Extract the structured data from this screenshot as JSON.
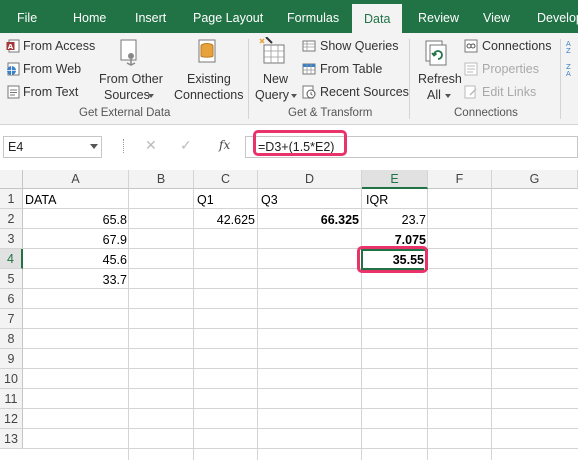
{
  "tabs": [
    {
      "label": "File"
    },
    {
      "label": "Home"
    },
    {
      "label": "Insert"
    },
    {
      "label": "Page Layout"
    },
    {
      "label": "Formulas"
    },
    {
      "label": "Data"
    },
    {
      "label": "Review"
    },
    {
      "label": "View"
    },
    {
      "label": "Develop"
    }
  ],
  "ribbon": {
    "get_external_data": {
      "label": "Get External Data",
      "from_access": "From Access",
      "from_web": "From Web",
      "from_text": "From Text",
      "from_other_sources_1": "From Other",
      "from_other_sources_2": "Sources",
      "existing_connections_1": "Existing",
      "existing_connections_2": "Connections"
    },
    "get_transform": {
      "label": "Get & Transform",
      "new_query_1": "New",
      "new_query_2": "Query",
      "show_queries": "Show Queries",
      "from_table": "From Table",
      "recent_sources": "Recent Sources"
    },
    "connections": {
      "label": "Connections",
      "refresh_all_1": "Refresh",
      "refresh_all_2": "All",
      "connections": "Connections",
      "properties": "Properties",
      "edit_links": "Edit Links"
    }
  },
  "formula_bar": {
    "name_box": "E4",
    "fx": "fx",
    "formula": "=D3+(1.5*E2)"
  },
  "columns": [
    "A",
    "B",
    "C",
    "D",
    "E",
    "F",
    "G"
  ],
  "rows": [
    "1",
    "2",
    "3",
    "4",
    "5",
    "6",
    "7",
    "8",
    "9",
    "10",
    "11",
    "12",
    "13"
  ],
  "cells": {
    "A1": "DATA",
    "A2": "65.8",
    "A3": "67.9",
    "A4": "45.6",
    "A5": "33.7",
    "C1": "Q1",
    "C2": "42.625",
    "D1": "Q3",
    "D2": "66.325",
    "E1": "IQR",
    "E2": "23.7",
    "E3": "7.075",
    "E4": "35.55"
  },
  "colors": {
    "excel_green": "#217346",
    "highlight": "#e8336b"
  }
}
